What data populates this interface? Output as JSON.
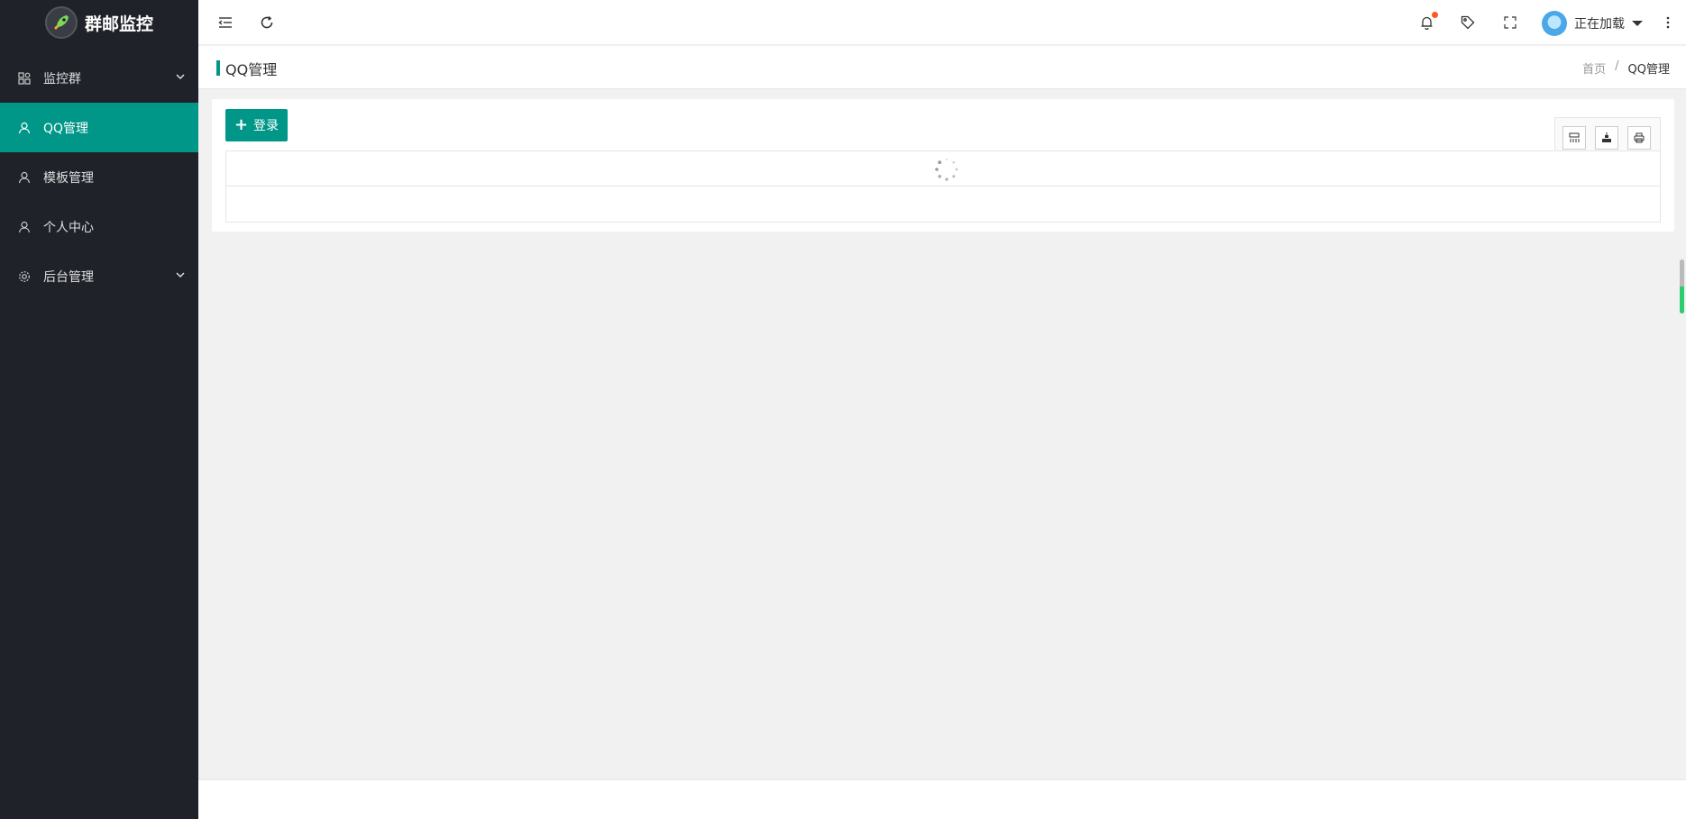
{
  "app": {
    "title": "群邮监控"
  },
  "sidebar": {
    "items": [
      {
        "label": "监控群",
        "icon": "dashboard-icon",
        "expandable": true
      },
      {
        "label": "QQ管理",
        "icon": "user-icon",
        "active": true
      },
      {
        "label": "模板管理",
        "icon": "user-icon"
      },
      {
        "label": "个人中心",
        "icon": "user-icon"
      },
      {
        "label": "后台管理",
        "icon": "gear-icon",
        "expandable": true
      }
    ]
  },
  "header": {
    "icons": [
      "menu-collapse-icon",
      "refresh-icon",
      "bell-icon",
      "tag-icon",
      "fullscreen-icon",
      "more-icon"
    ],
    "user": {
      "name": "正在加载"
    }
  },
  "page": {
    "title": "QQ管理",
    "breadcrumb": {
      "home": "首页",
      "separator": "/",
      "current": "QQ管理"
    }
  },
  "toolbar": {
    "login_label": "登录",
    "tools": [
      "columns-icon",
      "export-icon",
      "print-icon"
    ]
  },
  "colors": {
    "accent": "#009688",
    "sidebar_bg": "#20222a",
    "notify_dot": "#ff5722"
  }
}
